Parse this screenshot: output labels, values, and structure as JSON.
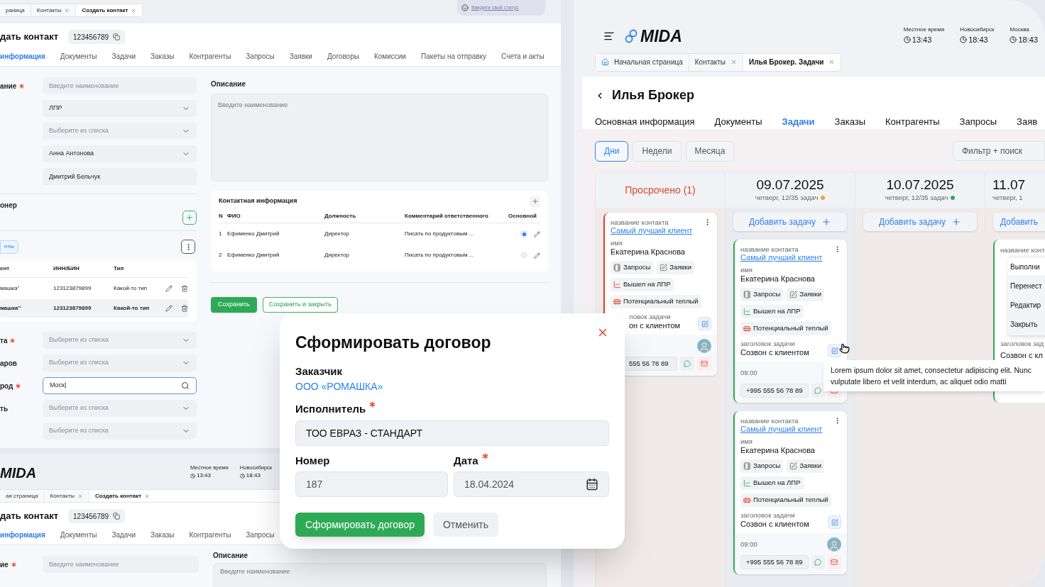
{
  "left_window": {
    "tabs": [
      {
        "label": "раница",
        "closable": false,
        "selected": false
      },
      {
        "label": "Контакты",
        "closable": true,
        "selected": false
      },
      {
        "label": "Создать контакт",
        "closable": true,
        "selected": true
      }
    ],
    "status_link": "Введите свой статус",
    "title": "дать контакт",
    "record_id": "123456789",
    "nav": [
      {
        "label": "информация",
        "selected": true
      },
      {
        "label": "Документы",
        "selected": false
      },
      {
        "label": "Задачи",
        "selected": false
      },
      {
        "label": "Заказы",
        "selected": false
      },
      {
        "label": "Контрагенты",
        "selected": false
      },
      {
        "label": "Запросы",
        "selected": false
      },
      {
        "label": "Заявки",
        "selected": false
      },
      {
        "label": "Договоры",
        "selected": false
      },
      {
        "label": "Комиссии",
        "selected": false
      },
      {
        "label": "Пакеты на отправку",
        "selected": false
      },
      {
        "label": "Счета и акты",
        "selected": false
      }
    ],
    "fields": [
      {
        "label": "ание",
        "required": true,
        "kind": "input",
        "placeholder": "Введите наименование"
      },
      {
        "kind": "select",
        "value": "ЛПР"
      },
      {
        "kind": "select",
        "placeholder": "Выберите из списка"
      },
      {
        "kind": "select",
        "value": "Анна Антонова"
      },
      {
        "kind": "input",
        "value": "Дмитрий Бельчук"
      }
    ],
    "section": "онер",
    "chip": "нты",
    "table": {
      "columns": [
        "ент",
        "ИНН/БИН",
        "Тип"
      ],
      "rows": [
        {
          "cells": [
            "машка\"",
            "123123879899",
            "Какой-то тип"
          ],
          "selected": false
        },
        {
          "cells": [
            "машка\"",
            "123123879899",
            "Какой-то тип"
          ],
          "selected": true
        }
      ]
    },
    "fields2": [
      {
        "label": "та",
        "required": true,
        "kind": "select",
        "placeholder": "Выберите из списка"
      },
      {
        "label": "аров",
        "kind": "select",
        "placeholder": "Выберите из списка"
      },
      {
        "label": "род",
        "required": true,
        "kind": "search",
        "value": "Моск|"
      },
      {
        "label": "ть",
        "kind": "select",
        "placeholder": "Выберите из списка"
      },
      {
        "kind": "select",
        "placeholder": "Выберите из списка"
      }
    ],
    "description": {
      "label": "Описание",
      "placeholder": "Введите наименование"
    },
    "contacts": {
      "title": "Контактная информация",
      "columns": [
        "N",
        "ФИО",
        "Должность",
        "Комментарий ответственного",
        "Основной"
      ],
      "rows": [
        {
          "cells": [
            "1",
            "Ефименко Дмитрий",
            "Директор",
            "Писать по продуктовым ..."
          ],
          "selected": true
        },
        {
          "cells": [
            "2",
            "Ефименко Дмитрий",
            "Директор",
            "Писать по продуктовым ..."
          ],
          "selected": false
        }
      ]
    },
    "buttons": [
      {
        "label": "Сохранить",
        "kind": "primary"
      },
      {
        "label": "Сохранить и закрыть",
        "kind": "outline"
      }
    ]
  },
  "bottom_window": {
    "logo": "MIDA",
    "times": [
      {
        "label": "Местное время",
        "value": "13:43"
      },
      {
        "label": "Новосибирск",
        "value": "18:43"
      }
    ],
    "tabs": [
      {
        "label": "ая страница",
        "closable": false,
        "selected": false
      },
      {
        "label": "Контакты",
        "closable": true,
        "selected": false
      },
      {
        "label": "Создать контакт",
        "closable": true,
        "selected": true
      }
    ],
    "title": "дать контакт",
    "record_id": "123456789",
    "nav": [
      {
        "label": "информация",
        "selected": true
      },
      {
        "label": "Документы",
        "selected": false
      },
      {
        "label": "Задачи",
        "selected": false
      },
      {
        "label": "Заказы",
        "selected": false
      },
      {
        "label": "Контрагенты",
        "selected": false
      },
      {
        "label": "Запросы",
        "selected": false
      }
    ],
    "fields": [
      {
        "label": "ие",
        "required": true,
        "kind": "input",
        "placeholder": "Введите наименование"
      }
    ],
    "description": {
      "label": "Описание",
      "placeholder": "Введите наименование"
    }
  },
  "modal": {
    "title": "Сформировать договор",
    "customer_label": "Заказчик",
    "customer": "ООО «РОМАШКА»",
    "executor": {
      "label": "Исполнитель",
      "required": true,
      "value": "ТОО ЕВРАЗ - СТАНДАРТ"
    },
    "number": {
      "label": "Номер",
      "value": "187"
    },
    "date": {
      "label": "Дата",
      "required": true,
      "value": "18.04.2024"
    },
    "buttons": [
      {
        "label": "Сформировать договор",
        "kind": "primary"
      },
      {
        "label": "Отменить",
        "kind": "secondary"
      }
    ]
  },
  "right_window": {
    "logo": "MIDA",
    "times": [
      {
        "label": "Местное время",
        "value": "13:43"
      },
      {
        "label": "Новосибирск",
        "value": "18:43"
      },
      {
        "label": "Москва",
        "value": "18:43"
      }
    ],
    "tabs": [
      {
        "label": "Начальная страница",
        "kind": "home",
        "selected": false
      },
      {
        "label": "Контакты",
        "kind": "closable",
        "selected": false
      },
      {
        "label": "Илья Брокер. Задачи",
        "kind": "closable",
        "selected": true
      }
    ],
    "title": "Илья Брокер",
    "nav": [
      {
        "label": "Основная информация",
        "selected": false
      },
      {
        "label": "Документы",
        "selected": false
      },
      {
        "label": "Задачи",
        "selected": true
      },
      {
        "label": "Заказы",
        "selected": false
      },
      {
        "label": "Контрагенты",
        "selected": false
      },
      {
        "label": "Запросы",
        "selected": false
      },
      {
        "label": "Заяв",
        "selected": false
      }
    ],
    "views": [
      {
        "label": "Дни",
        "selected": true
      },
      {
        "label": "Недели",
        "selected": false
      },
      {
        "label": "Месяца",
        "selected": false
      }
    ],
    "filter": {
      "placeholder": "Фильтр + поиск"
    },
    "columns": [
      {
        "kind": "overdue",
        "title": "Просрочено (1)",
        "cards": [
          {
            "overdue": true,
            "covered": true,
            "contact_label": "название контакта",
            "contact": "Самый лучший клиент",
            "name_label": "имя",
            "name": "Екатерина Краснова",
            "tags": [
              {
                "label": "Запросы",
                "kind": "requests"
              },
              {
                "label": "Заявки",
                "kind": "applications"
              },
              {
                "label": "Вышел на ЛПР",
                "kind": "lpr"
              },
              {
                "label": "Потенциальный теплый",
                "kind": "potential"
              }
            ],
            "task_label": "ловок задачи",
            "task": "он с клиентом",
            "avatar": true,
            "phone": "555 56 78 89"
          }
        ]
      },
      {
        "kind": "day",
        "date": "09.07.2025",
        "subtitle": "четверг, 12/35 задач",
        "color": "#f2a33a",
        "add": "Добавить задачу",
        "cards": [
          {
            "overdue": false,
            "covered": false,
            "hovered": true,
            "contact_label": "название контакта",
            "contact": "Самый лучший клиент",
            "name_label": "имя",
            "name": "Екатерина Краснова",
            "tags": [
              {
                "label": "Запросы",
                "kind": "requests"
              },
              {
                "label": "Заявки",
                "kind": "applications"
              },
              {
                "label": "Вышел на ЛПР",
                "kind": "lpr"
              },
              {
                "label": "Потенциальный теплый",
                "kind": "potential"
              }
            ],
            "task_label": "заголовок задачи",
            "task": "Созвон с клиентом",
            "time": "09:00",
            "avatar": false,
            "phone": "+995 555 56 78 89"
          },
          {
            "overdue": false,
            "covered": false,
            "hovered": false,
            "contact_label": "название контакта",
            "contact": "Самый лучший клиент",
            "name_label": "имя",
            "name": "Екатерина Краснова",
            "tags": [
              {
                "label": "Запросы",
                "kind": "requests"
              },
              {
                "label": "Заявки",
                "kind": "applications"
              },
              {
                "label": "Вышел на ЛПР",
                "kind": "lpr"
              },
              {
                "label": "Потенциальный теплый",
                "kind": "potential"
              }
            ],
            "task_label": "заголовок задачи",
            "task": "Созвон с клиентом",
            "time": "09:00",
            "avatar": true,
            "phone": "+995 555 56 78 89"
          }
        ]
      },
      {
        "kind": "day",
        "date": "10.07.2025",
        "subtitle": "четверг, 12/35 задач",
        "color": "#27ae60",
        "add": "Добавить задачу"
      },
      {
        "kind": "partial",
        "date": "11.07",
        "subtitle": "четверг, 1",
        "add": "Добавить",
        "card": {
          "contact_label": "название конт",
          "task_label": "заголовок зад",
          "task": "Созвон с кл"
        },
        "menu": [
          {
            "label": "Выполни",
            "selected": true
          },
          {
            "label": "Перенест",
            "selected": false
          },
          {
            "label": "Редактир",
            "selected": false
          },
          {
            "label": "Закрыть",
            "selected": false
          }
        ]
      }
    ],
    "tooltip": "Lorem ipsum dolor sit amet, consectetur adipiscing elit. Nunc vulputate libero et velit interdum, ac aliquet odio matti"
  }
}
